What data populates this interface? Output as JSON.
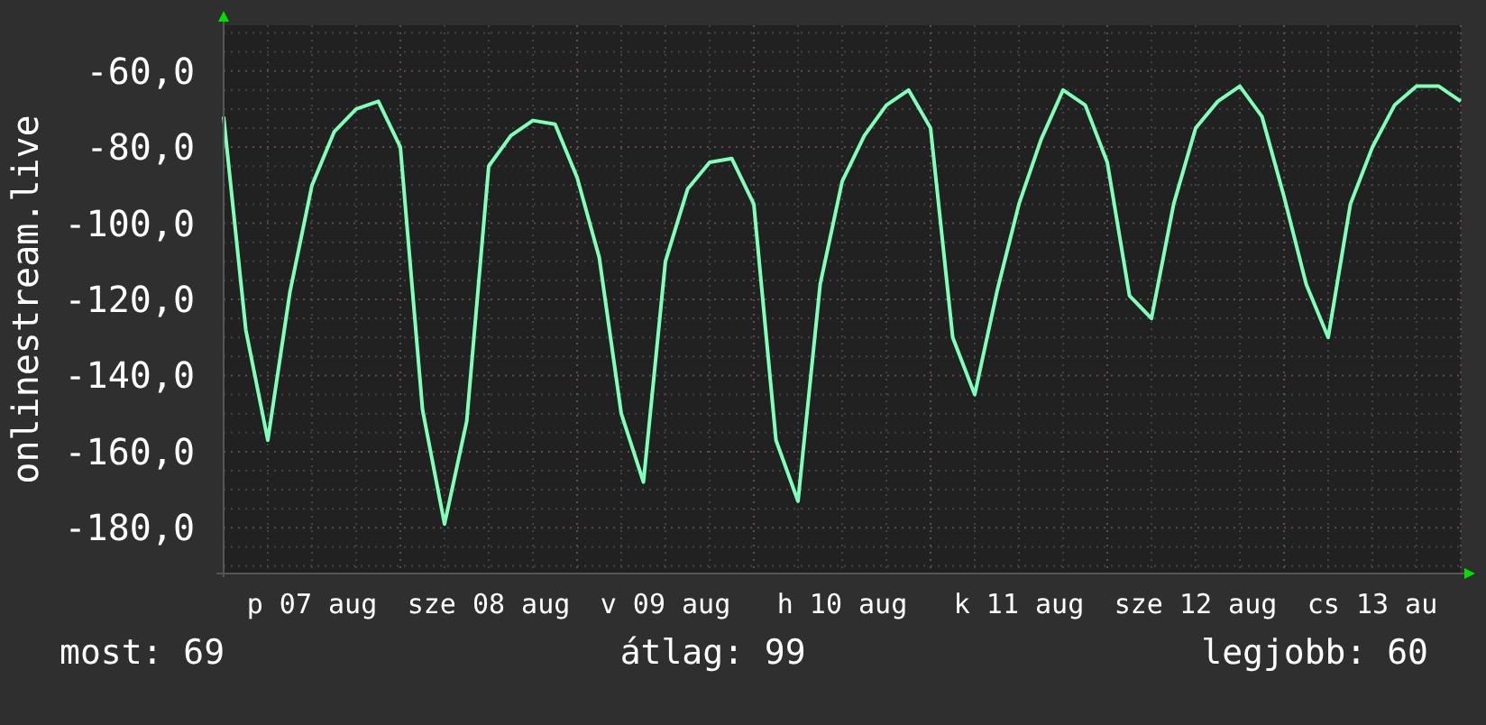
{
  "chart": {
    "chart_data": {
      "type": "line",
      "ylabel": "onlinestream.live",
      "categories": [
        null,
        null,
        null,
        null,
        "p 07 aug",
        null,
        null,
        null,
        null,
        null,
        null,
        null,
        "sze 08 aug",
        null,
        null,
        null,
        null,
        null,
        null,
        null,
        "v 09 aug",
        null,
        null,
        null,
        null,
        null,
        null,
        null,
        "h 10 aug",
        null,
        null,
        null,
        null,
        null,
        null,
        null,
        "k 11 aug",
        null,
        null,
        null,
        null,
        null,
        null,
        null,
        "sze 12 aug",
        null,
        null,
        null,
        null,
        null,
        null,
        null,
        "cs 13 au",
        null,
        null,
        null,
        null
      ],
      "series": [
        {
          "color": "#80ffb8",
          "values": [
            -72,
            -128,
            -157,
            -118,
            -90,
            -76,
            -70,
            -68,
            -80,
            -149,
            -179,
            -152,
            -85,
            -77,
            -73,
            -74,
            -88,
            -109,
            -150,
            -168,
            -110,
            -91,
            -84,
            -83,
            -95,
            -157,
            -173,
            -116,
            -89,
            -77,
            -69,
            -65,
            -75,
            -130,
            -145,
            -118,
            -95,
            -78,
            -65,
            -69,
            -84,
            -119,
            -125,
            -95,
            -75,
            -68,
            -64,
            -72,
            -93,
            -116,
            -130,
            -95,
            -80,
            -69,
            -64,
            -64,
            -68
          ]
        }
      ],
      "ylim": [
        -192,
        -48
      ],
      "grid": true,
      "yticks": [
        {
          "value": -60,
          "label": "-60,0"
        },
        {
          "value": -80,
          "label": "-80,0"
        },
        {
          "value": -100,
          "label": "-100,0"
        },
        {
          "value": -120,
          "label": "-120,0"
        },
        {
          "value": -140,
          "label": "-140,0"
        },
        {
          "value": -160,
          "label": "-160,0"
        },
        {
          "value": -180,
          "label": "-180,0"
        }
      ]
    }
  },
  "legend": [
    {
      "label": "most: 69"
    },
    {
      "label": "átlag: 99"
    },
    {
      "label": "legjobb: 60"
    }
  ]
}
